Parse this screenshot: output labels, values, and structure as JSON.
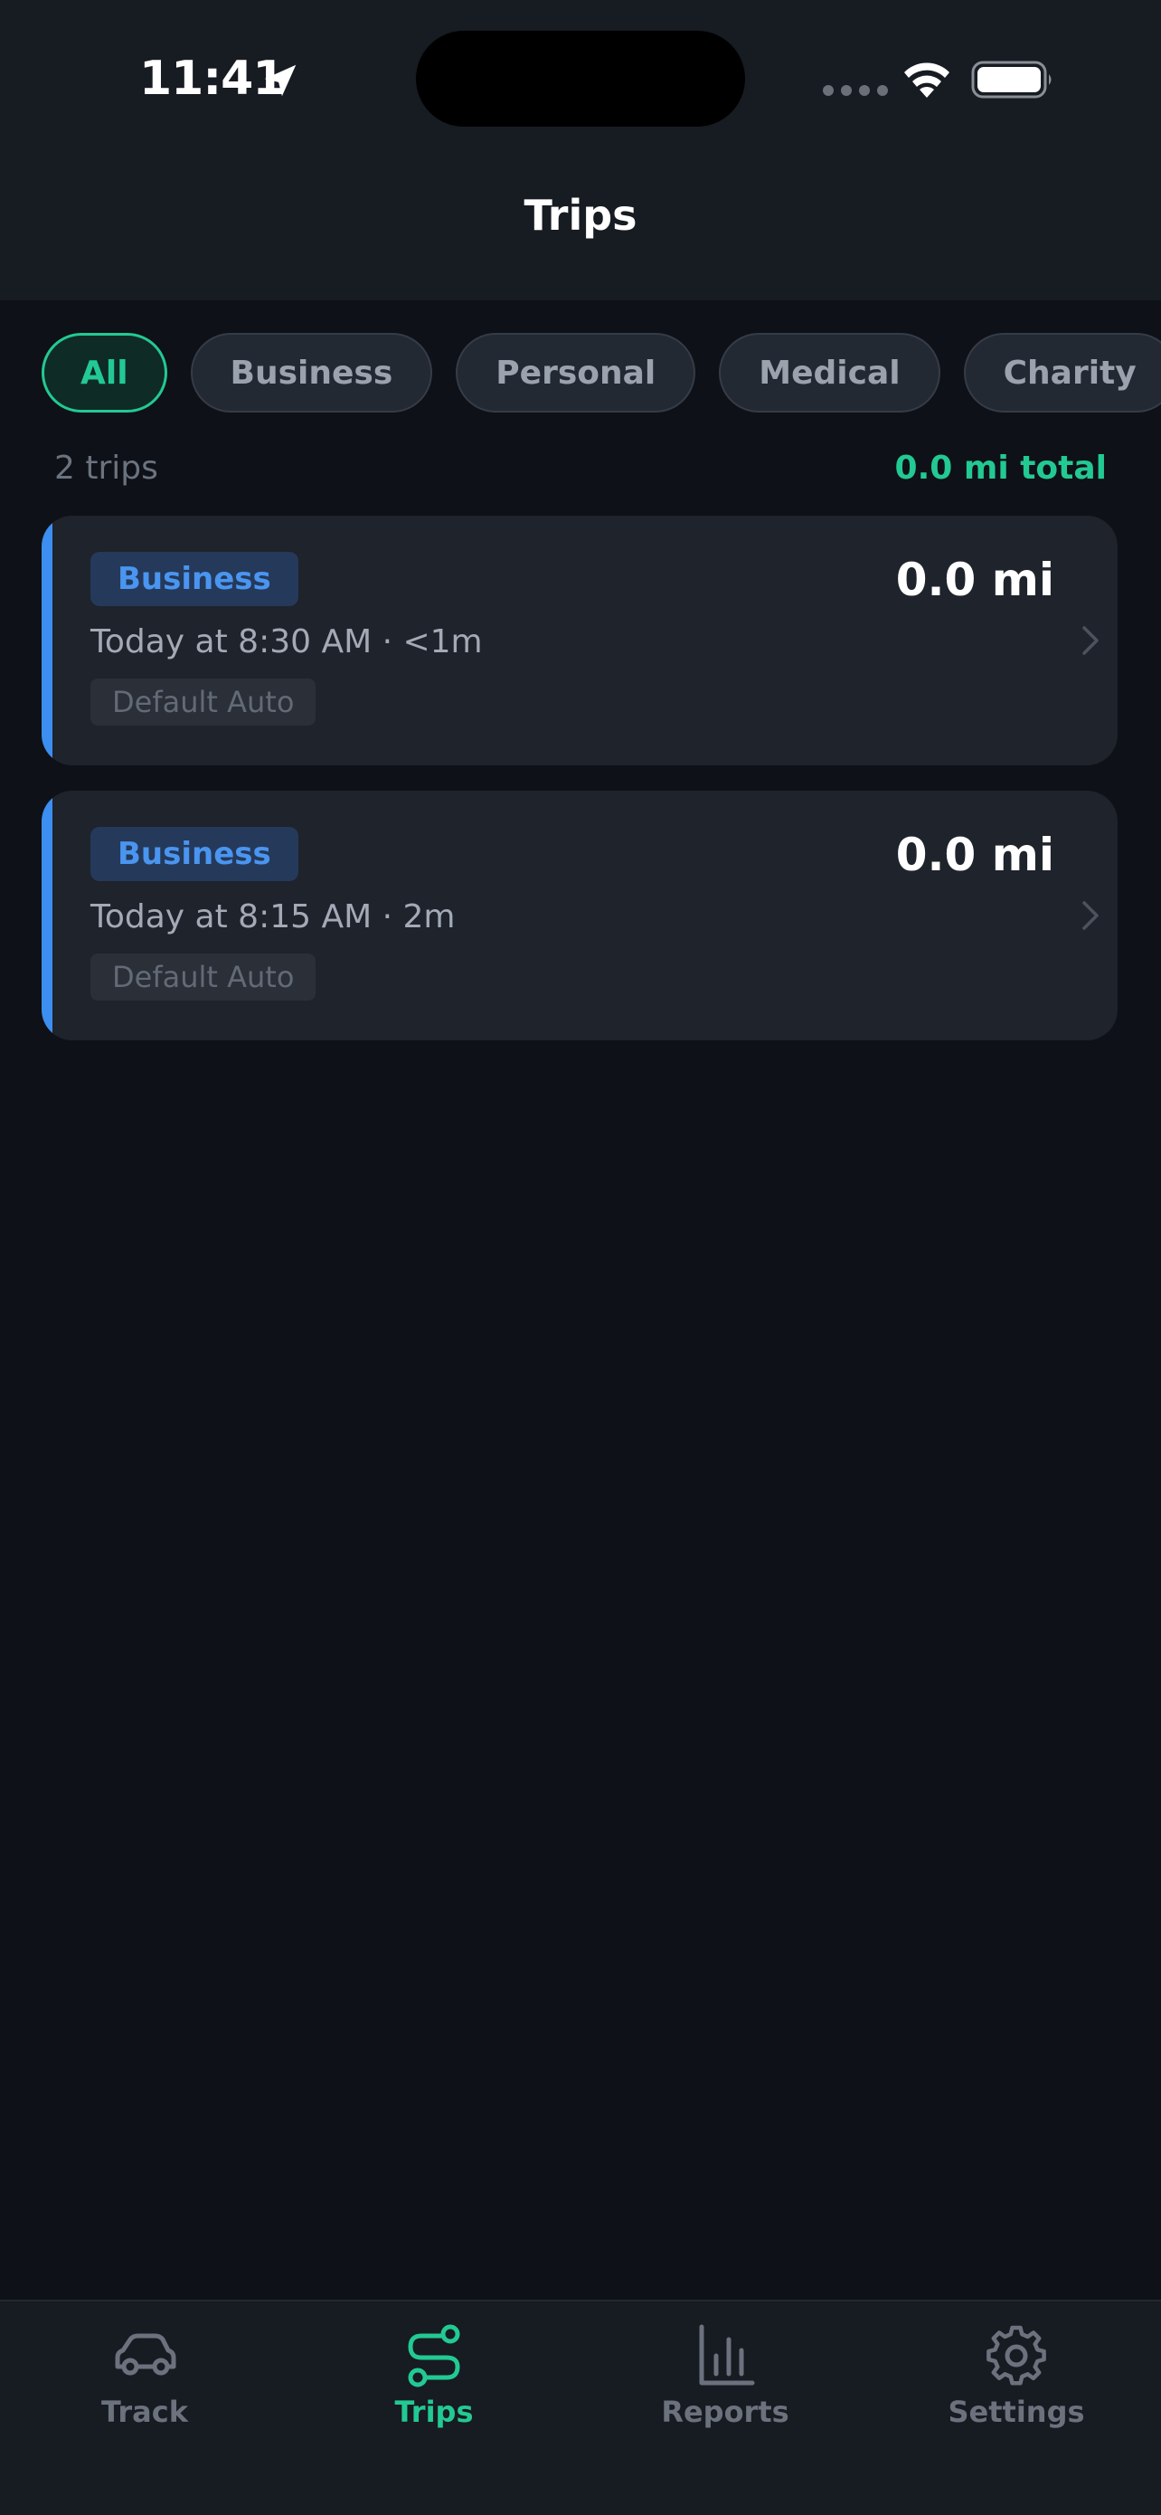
{
  "status_bar": {
    "time": "11:41"
  },
  "header": {
    "title": "Trips"
  },
  "filters": [
    {
      "label": "All",
      "active": true
    },
    {
      "label": "Business",
      "active": false
    },
    {
      "label": "Personal",
      "active": false
    },
    {
      "label": "Medical",
      "active": false
    },
    {
      "label": "Charity",
      "active": false
    }
  ],
  "summary": {
    "count": "2 trips",
    "total": "0.0 mi total"
  },
  "trips": [
    {
      "type": "Business",
      "distance": "0.0 mi",
      "when": "Today at 8:30 AM · <1m",
      "vehicle": "Default Auto"
    },
    {
      "type": "Business",
      "distance": "0.0 mi",
      "when": "Today at 8:15 AM · 2m",
      "vehicle": "Default Auto"
    }
  ],
  "tabs": [
    {
      "label": "Track",
      "icon": "car-icon",
      "active": false
    },
    {
      "label": "Trips",
      "icon": "route-icon",
      "active": true
    },
    {
      "label": "Reports",
      "icon": "bar-chart-icon",
      "active": false
    },
    {
      "label": "Settings",
      "icon": "gear-icon",
      "active": false
    }
  ],
  "colors": {
    "accent": "#23c993",
    "business": "#3c8ef0",
    "background": "#0e1117",
    "card": "#1e232c"
  }
}
